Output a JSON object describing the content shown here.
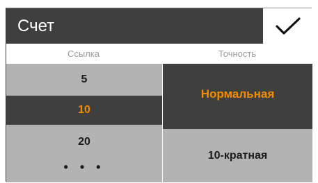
{
  "header": {
    "title": "Счет",
    "confirm_icon": "checkmark-icon"
  },
  "columns": {
    "left_header": "Ссылка",
    "right_header": "Точность"
  },
  "reference_list": {
    "items": [
      "5",
      "10",
      "20"
    ],
    "selected": "10",
    "more": "• • •"
  },
  "precision_list": {
    "items": [
      "Нормальная",
      "10-кратная"
    ],
    "selected": "Нормальная"
  },
  "colors": {
    "dark_bg": "#3f3f3f",
    "light_bg": "#b3b3b3",
    "accent": "#f28c00",
    "header_text": "#9b9b9b"
  }
}
